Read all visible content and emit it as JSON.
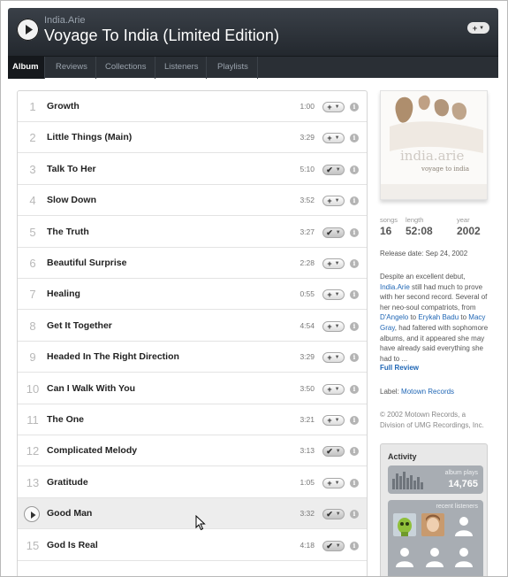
{
  "header": {
    "artist": "India.Arie",
    "album_title": "Voyage To India (Limited Edition)",
    "add_button_label": "+"
  },
  "tabs": [
    {
      "label": "Album",
      "active": true
    },
    {
      "label": "Reviews",
      "active": false
    },
    {
      "label": "Collections",
      "active": false
    },
    {
      "label": "Listeners",
      "active": false
    },
    {
      "label": "Playlists",
      "active": false
    }
  ],
  "tracks": [
    {
      "num": "1",
      "name": "Growth",
      "length": "1:00",
      "action": "+"
    },
    {
      "num": "2",
      "name": "Little Things (Main)",
      "length": "3:29",
      "action": "+"
    },
    {
      "num": "3",
      "name": "Talk To Her",
      "length": "5:10",
      "action": "✔"
    },
    {
      "num": "4",
      "name": "Slow Down",
      "length": "3:52",
      "action": "+"
    },
    {
      "num": "5",
      "name": "The Truth",
      "length": "3:27",
      "action": "✔"
    },
    {
      "num": "6",
      "name": "Beautiful Surprise",
      "length": "2:28",
      "action": "+"
    },
    {
      "num": "7",
      "name": "Healing",
      "length": "0:55",
      "action": "+"
    },
    {
      "num": "8",
      "name": "Get It Together",
      "length": "4:54",
      "action": "+"
    },
    {
      "num": "9",
      "name": "Headed In The Right Direction",
      "length": "3:29",
      "action": "+"
    },
    {
      "num": "10",
      "name": "Can I Walk With You",
      "length": "3:50",
      "action": "+"
    },
    {
      "num": "11",
      "name": "The One",
      "length": "3:21",
      "action": "+"
    },
    {
      "num": "12",
      "name": "Complicated Melody",
      "length": "3:13",
      "action": "✔"
    },
    {
      "num": "13",
      "name": "Gratitude",
      "length": "1:05",
      "action": "+"
    },
    {
      "num": "14",
      "name": "Good Man",
      "length": "3:32",
      "action": "✔",
      "playing": true
    },
    {
      "num": "15",
      "name": "God Is Real",
      "length": "4:18",
      "action": "✔"
    }
  ],
  "cover": {
    "artist_text": "india.arie",
    "album_text": "voyage to india"
  },
  "stats": {
    "songs_label": "songs",
    "songs": "16",
    "length_label": "length",
    "length": "52:08",
    "year_label": "year",
    "year": "2002"
  },
  "release_date": "Release date: Sep 24, 2002",
  "review": {
    "p1": "Despite an excellent debut,",
    "artist_link": "India.Arie",
    "p2": " still had much to prove with her second record. Several of her neo-soul compatriots, from ",
    "link_dangelo": "D'Angelo",
    "p3": " to ",
    "link_badu": "Erykah Badu",
    "p4": " to ",
    "link_gray": "Macy Gray",
    "p5": ", had faltered with sophomore albums, and it appeared she may have already said everything she had to ..."
  },
  "full_review_label": "Full Review",
  "label_prefix": "Label: ",
  "label_name": "Motown Records",
  "copyright": "© 2002 Motown Records, a Division of UMG Recordings, Inc.",
  "activity": {
    "title": "Activity",
    "plays_label": "album plays",
    "plays_value": "14,765",
    "listeners_label": "recent listeners"
  },
  "colors": {
    "header_bg": "#2f353c",
    "link": "#1f66b5",
    "playing_row": "#ededed"
  }
}
